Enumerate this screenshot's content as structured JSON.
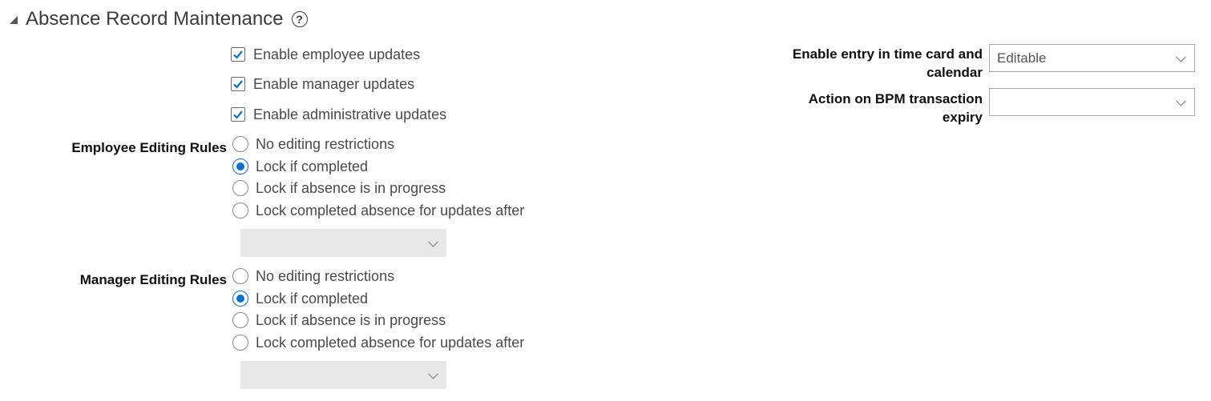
{
  "section": {
    "title": "Absence Record Maintenance",
    "help_glyph": "?"
  },
  "checkboxes": [
    {
      "label": "Enable employee updates",
      "checked": true
    },
    {
      "label": "Enable manager updates",
      "checked": true
    },
    {
      "label": "Enable administrative updates",
      "checked": true
    }
  ],
  "employee_rules": {
    "label": "Employee Editing Rules",
    "options": [
      {
        "label": "No editing restrictions",
        "selected": false
      },
      {
        "label": "Lock if completed",
        "selected": true
      },
      {
        "label": "Lock if absence is in progress",
        "selected": false
      },
      {
        "label": "Lock completed absence for updates after",
        "selected": false
      }
    ],
    "select_value": ""
  },
  "manager_rules": {
    "label": "Manager Editing Rules",
    "options": [
      {
        "label": "No editing restrictions",
        "selected": false
      },
      {
        "label": "Lock if completed",
        "selected": true
      },
      {
        "label": "Lock if absence is in progress",
        "selected": false
      },
      {
        "label": "Lock completed absence for updates after",
        "selected": false
      }
    ],
    "select_value": ""
  },
  "right_fields": {
    "time_card": {
      "label_line1": "Enable entry in time card and",
      "label_line2": "calendar",
      "value": "Editable"
    },
    "bpm_expiry": {
      "label_line1": "Action on BPM transaction",
      "label_line2": "expiry",
      "value": ""
    }
  },
  "colors": {
    "accent": "#0572ce",
    "checkmark": "#0572ce",
    "disabled_fill": "#e8e8e8"
  }
}
